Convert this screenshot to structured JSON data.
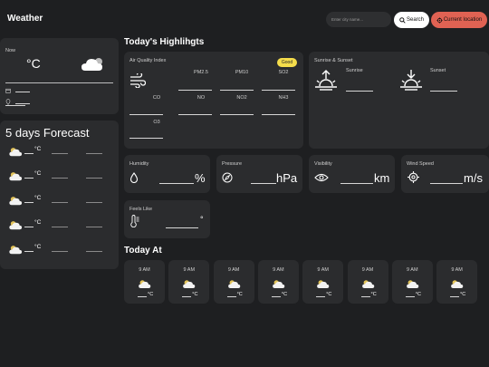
{
  "header": {
    "brand": "Weather",
    "search_placeholder": "Enter city name...",
    "search_label": "Search",
    "location_label": "Current location"
  },
  "now": {
    "label": "Now",
    "temp_unit": "°C"
  },
  "forecast": {
    "title": "5 days Forecast",
    "rows": [
      {
        "unit": "°C"
      },
      {
        "unit": "°C"
      },
      {
        "unit": "°C"
      },
      {
        "unit": "°C"
      },
      {
        "unit": "°C"
      }
    ]
  },
  "highlights": {
    "title": "Today's Highlihgts",
    "aqi": {
      "title": "Air Quality Index",
      "badge": "Good",
      "labels": [
        "PM2.5",
        "PM10",
        "SO2",
        "CO",
        "NO",
        "NO2",
        "NH3",
        "O3"
      ]
    },
    "sun": {
      "title": "Sunrise & Sunset",
      "sunrise": "Sunrise",
      "sunset": "Sunset"
    },
    "humidity": {
      "title": "Humidity",
      "unit": "%"
    },
    "pressure": {
      "title": "Pressure",
      "unit": "hPa"
    },
    "visibility": {
      "title": "Visibility",
      "unit": "km"
    },
    "wind": {
      "title": "Wind Speed",
      "unit": "m/s"
    },
    "feels": {
      "title": "Feels Like",
      "unit": "°"
    }
  },
  "today_at": {
    "title": "Today At",
    "cards": [
      {
        "time": "9 AM",
        "unit": "°C"
      },
      {
        "time": "9 AM",
        "unit": "°C"
      },
      {
        "time": "9 AM",
        "unit": "°C"
      },
      {
        "time": "9 AM",
        "unit": "°C"
      },
      {
        "time": "9 AM",
        "unit": "°C"
      },
      {
        "time": "9 AM",
        "unit": "°C"
      },
      {
        "time": "9 AM",
        "unit": "°C"
      },
      {
        "time": "9 AM",
        "unit": "°C"
      }
    ]
  }
}
